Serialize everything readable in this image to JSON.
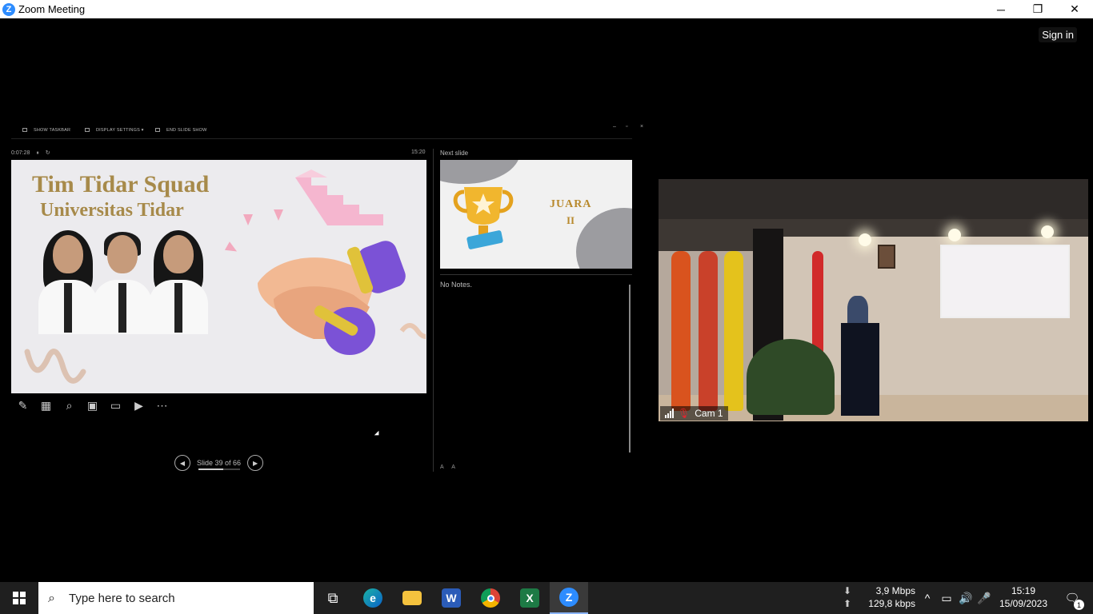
{
  "window": {
    "title": "Zoom Meeting",
    "minimize": "─",
    "restore": "❐",
    "close": "✕",
    "sign_in": "Sign in"
  },
  "presenter": {
    "toolbar": {
      "show_taskbar": "SHOW TASKBAR",
      "display_settings": "DISPLAY SETTINGS ▾",
      "end_slide_show": "END SLIDE SHOW"
    },
    "elapsed": "0:07:28",
    "clock": "15:20",
    "slide": {
      "title": "Tim Tidar Squad",
      "subtitle": "Universitas Tidar"
    },
    "slide_counter": "Slide 39 of 66",
    "slide_current": 39,
    "slide_total": 66,
    "next_slide_label": "Next slide",
    "next_slide": {
      "title": "JUARA",
      "rank": "II"
    },
    "notes": "No Notes.",
    "font_larger": "A",
    "font_smaller": "A"
  },
  "camera": {
    "participant_name": "Cam 1",
    "muted": true
  },
  "taskbar": {
    "search_placeholder": "Type here to search",
    "net_down": "3,9 Mbps",
    "net_up": "129,8 kbps",
    "time": "15:19",
    "date": "15/09/2023",
    "notification_count": "1",
    "apps": [
      "task-view",
      "edge",
      "file-explorer",
      "word",
      "chrome",
      "excel",
      "zoom"
    ]
  },
  "colors": {
    "zoom_blue": "#2d8cff",
    "slide_gold": "#a78a4a",
    "muted_red": "#e0262f"
  }
}
